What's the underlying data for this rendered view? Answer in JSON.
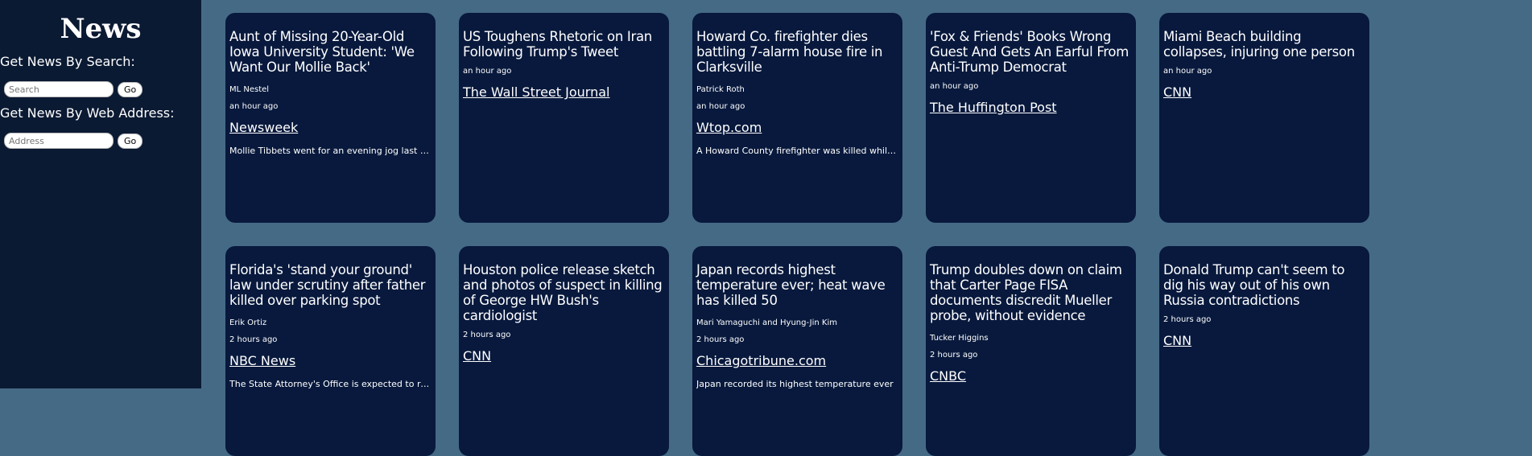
{
  "app": {
    "title": "News"
  },
  "sidebar": {
    "search_label": "Get News By Search:",
    "search_placeholder": "Search",
    "search_button": "Go",
    "address_label": "Get News By Web Address:",
    "address_placeholder": "Address",
    "address_button": "Go"
  },
  "articles": [
    {
      "headline": "Aunt of Missing 20-Year-Old Iowa University Student: 'We Want Our Mollie Back'",
      "author": "ML Nestel",
      "time": "an hour ago",
      "source": "Newsweek",
      "description": "Mollie Tibbets went for an evening jog last Tuesday"
    },
    {
      "headline": "US Toughens Rhetoric on Iran Following Trump's Tweet",
      "author": "",
      "time": "an hour ago",
      "source": "The Wall Street Journal",
      "description": ""
    },
    {
      "headline": "Howard Co. firefighter dies battling 7-alarm house fire in Clarksville",
      "author": "Patrick Roth",
      "time": "an hour ago",
      "source": "Wtop.com",
      "description": "A Howard County firefighter was killed while battling"
    },
    {
      "headline": "'Fox & Friends' Books Wrong Guest And Gets An Earful From Anti-Trump Democrat",
      "author": "",
      "time": "an hour ago",
      "source": "The Huffington Post",
      "description": ""
    },
    {
      "headline": "Miami Beach building collapses, injuring one person",
      "author": "",
      "time": "an hour ago",
      "source": "CNN",
      "description": ""
    },
    {
      "headline": "Florida's 'stand your ground' law under scrutiny after father killed over parking spot",
      "author": "Erik Ortiz",
      "time": "2 hours ago",
      "source": "NBC News",
      "description": "The State Attorney's Office is expected to review"
    },
    {
      "headline": "Houston police release sketch and photos of suspect in killing of George HW Bush's cardiologist",
      "author": "",
      "time": "2 hours ago",
      "source": "CNN",
      "description": ""
    },
    {
      "headline": "Japan records highest temperature ever; heat wave has killed 50",
      "author": "Mari Yamaguchi and Hyung-Jin Kim",
      "time": "2 hours ago",
      "source": "Chicagotribune.com",
      "description": "Japan recorded its highest temperature ever"
    },
    {
      "headline": "Trump doubles down on claim that Carter Page FISA documents discredit Mueller probe, without evidence",
      "author": "Tucker Higgins",
      "time": "2 hours ago",
      "source": "CNBC",
      "description": ""
    },
    {
      "headline": "Donald Trump can't seem to dig his way out of his own Russia contradictions",
      "author": "",
      "time": "2 hours ago",
      "source": "CNN",
      "description": ""
    }
  ]
}
